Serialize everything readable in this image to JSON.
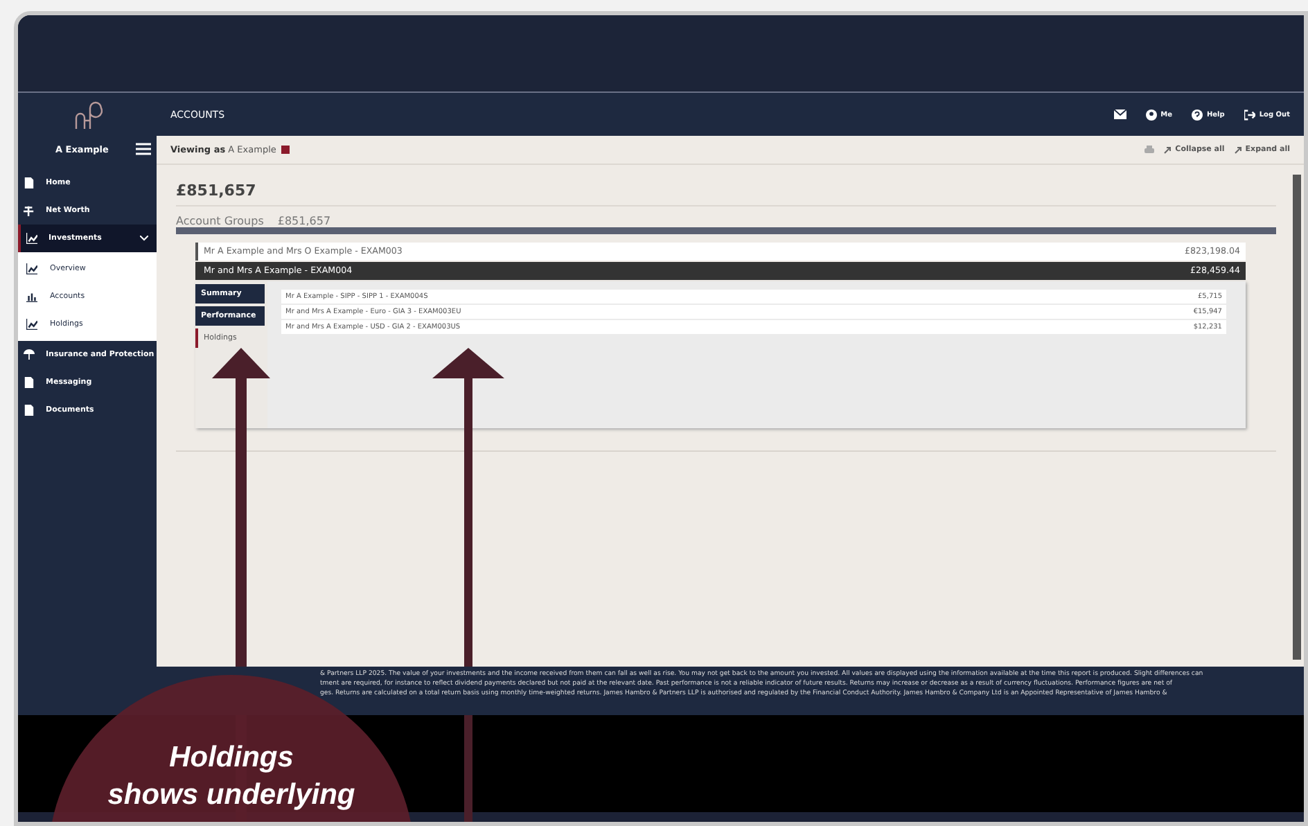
{
  "header": {
    "title": "ACCOUNTS",
    "actions": [
      {
        "kind": "user",
        "label": "Me"
      },
      {
        "kind": "help",
        "label": "Help"
      },
      {
        "kind": "logout",
        "label": "Log Out"
      }
    ]
  },
  "sidebar": {
    "user": "A Example",
    "items": [
      {
        "label": "Home",
        "selected": false
      },
      {
        "label": "Net Worth",
        "selected": false
      },
      {
        "label": "Investments",
        "selected": true,
        "expanded": true,
        "children": [
          {
            "label": "Overview"
          },
          {
            "label": "Accounts"
          },
          {
            "label": "Holdings"
          }
        ]
      },
      {
        "label": "Insurance and Protection",
        "selected": false
      },
      {
        "label": "Messaging",
        "selected": false
      },
      {
        "label": "Documents",
        "selected": false
      }
    ]
  },
  "viewing": {
    "prefix": "Viewing as",
    "name": "A Example",
    "tools": [
      "Collapse all",
      "Expand all"
    ]
  },
  "total": "£851,657",
  "account_groups": {
    "label": "Account Groups",
    "value": "£851,657"
  },
  "groups": [
    {
      "name": "Mr A Example and Mrs O Example - EXAM003",
      "value": "£823,198.04",
      "expanded": false
    },
    {
      "name": "Mr and Mrs A Example - EXAM004",
      "value": "£28,459.44",
      "expanded": true
    }
  ],
  "tabs": [
    {
      "label": "Summary",
      "selected": false
    },
    {
      "label": "Performance",
      "selected": false
    },
    {
      "label": "Holdings",
      "selected": true
    }
  ],
  "accounts": [
    {
      "name": "Mr A Example - SIPP - SIPP 1 - EXAM004S",
      "value": "£5,715"
    },
    {
      "name": "Mr and Mrs A Example - Euro - GIA 3 - EXAM003EU",
      "value": "€15,947"
    },
    {
      "name": "Mr and Mrs A Example - USD - GIA 2 - EXAM003US",
      "value": "$12,231"
    }
  ],
  "footer": [
    "& Partners LLP 2025. The value of your investments and the income received from them can fall as well as rise. You may not get back to the amount you invested. All values are displayed using the information available at the time this report is produced. Slight differences can",
    "tment are required, for instance to reflect dividend payments declared but not paid at the relevant date. Past performance is not a reliable indicator of future results. Returns may increase or decrease as a result of currency fluctuations. Performance figures are net of",
    "ges. Returns are calculated on a total return basis using monthly time-weighted returns. James Hambro & Partners LLP is authorised and regulated by the Financial Conduct Authority. James Hambro & Company Ltd is an Appointed Representative of James Hambro &"
  ],
  "callout": {
    "lines": [
      "Holdings",
      "shows underlying"
    ]
  }
}
